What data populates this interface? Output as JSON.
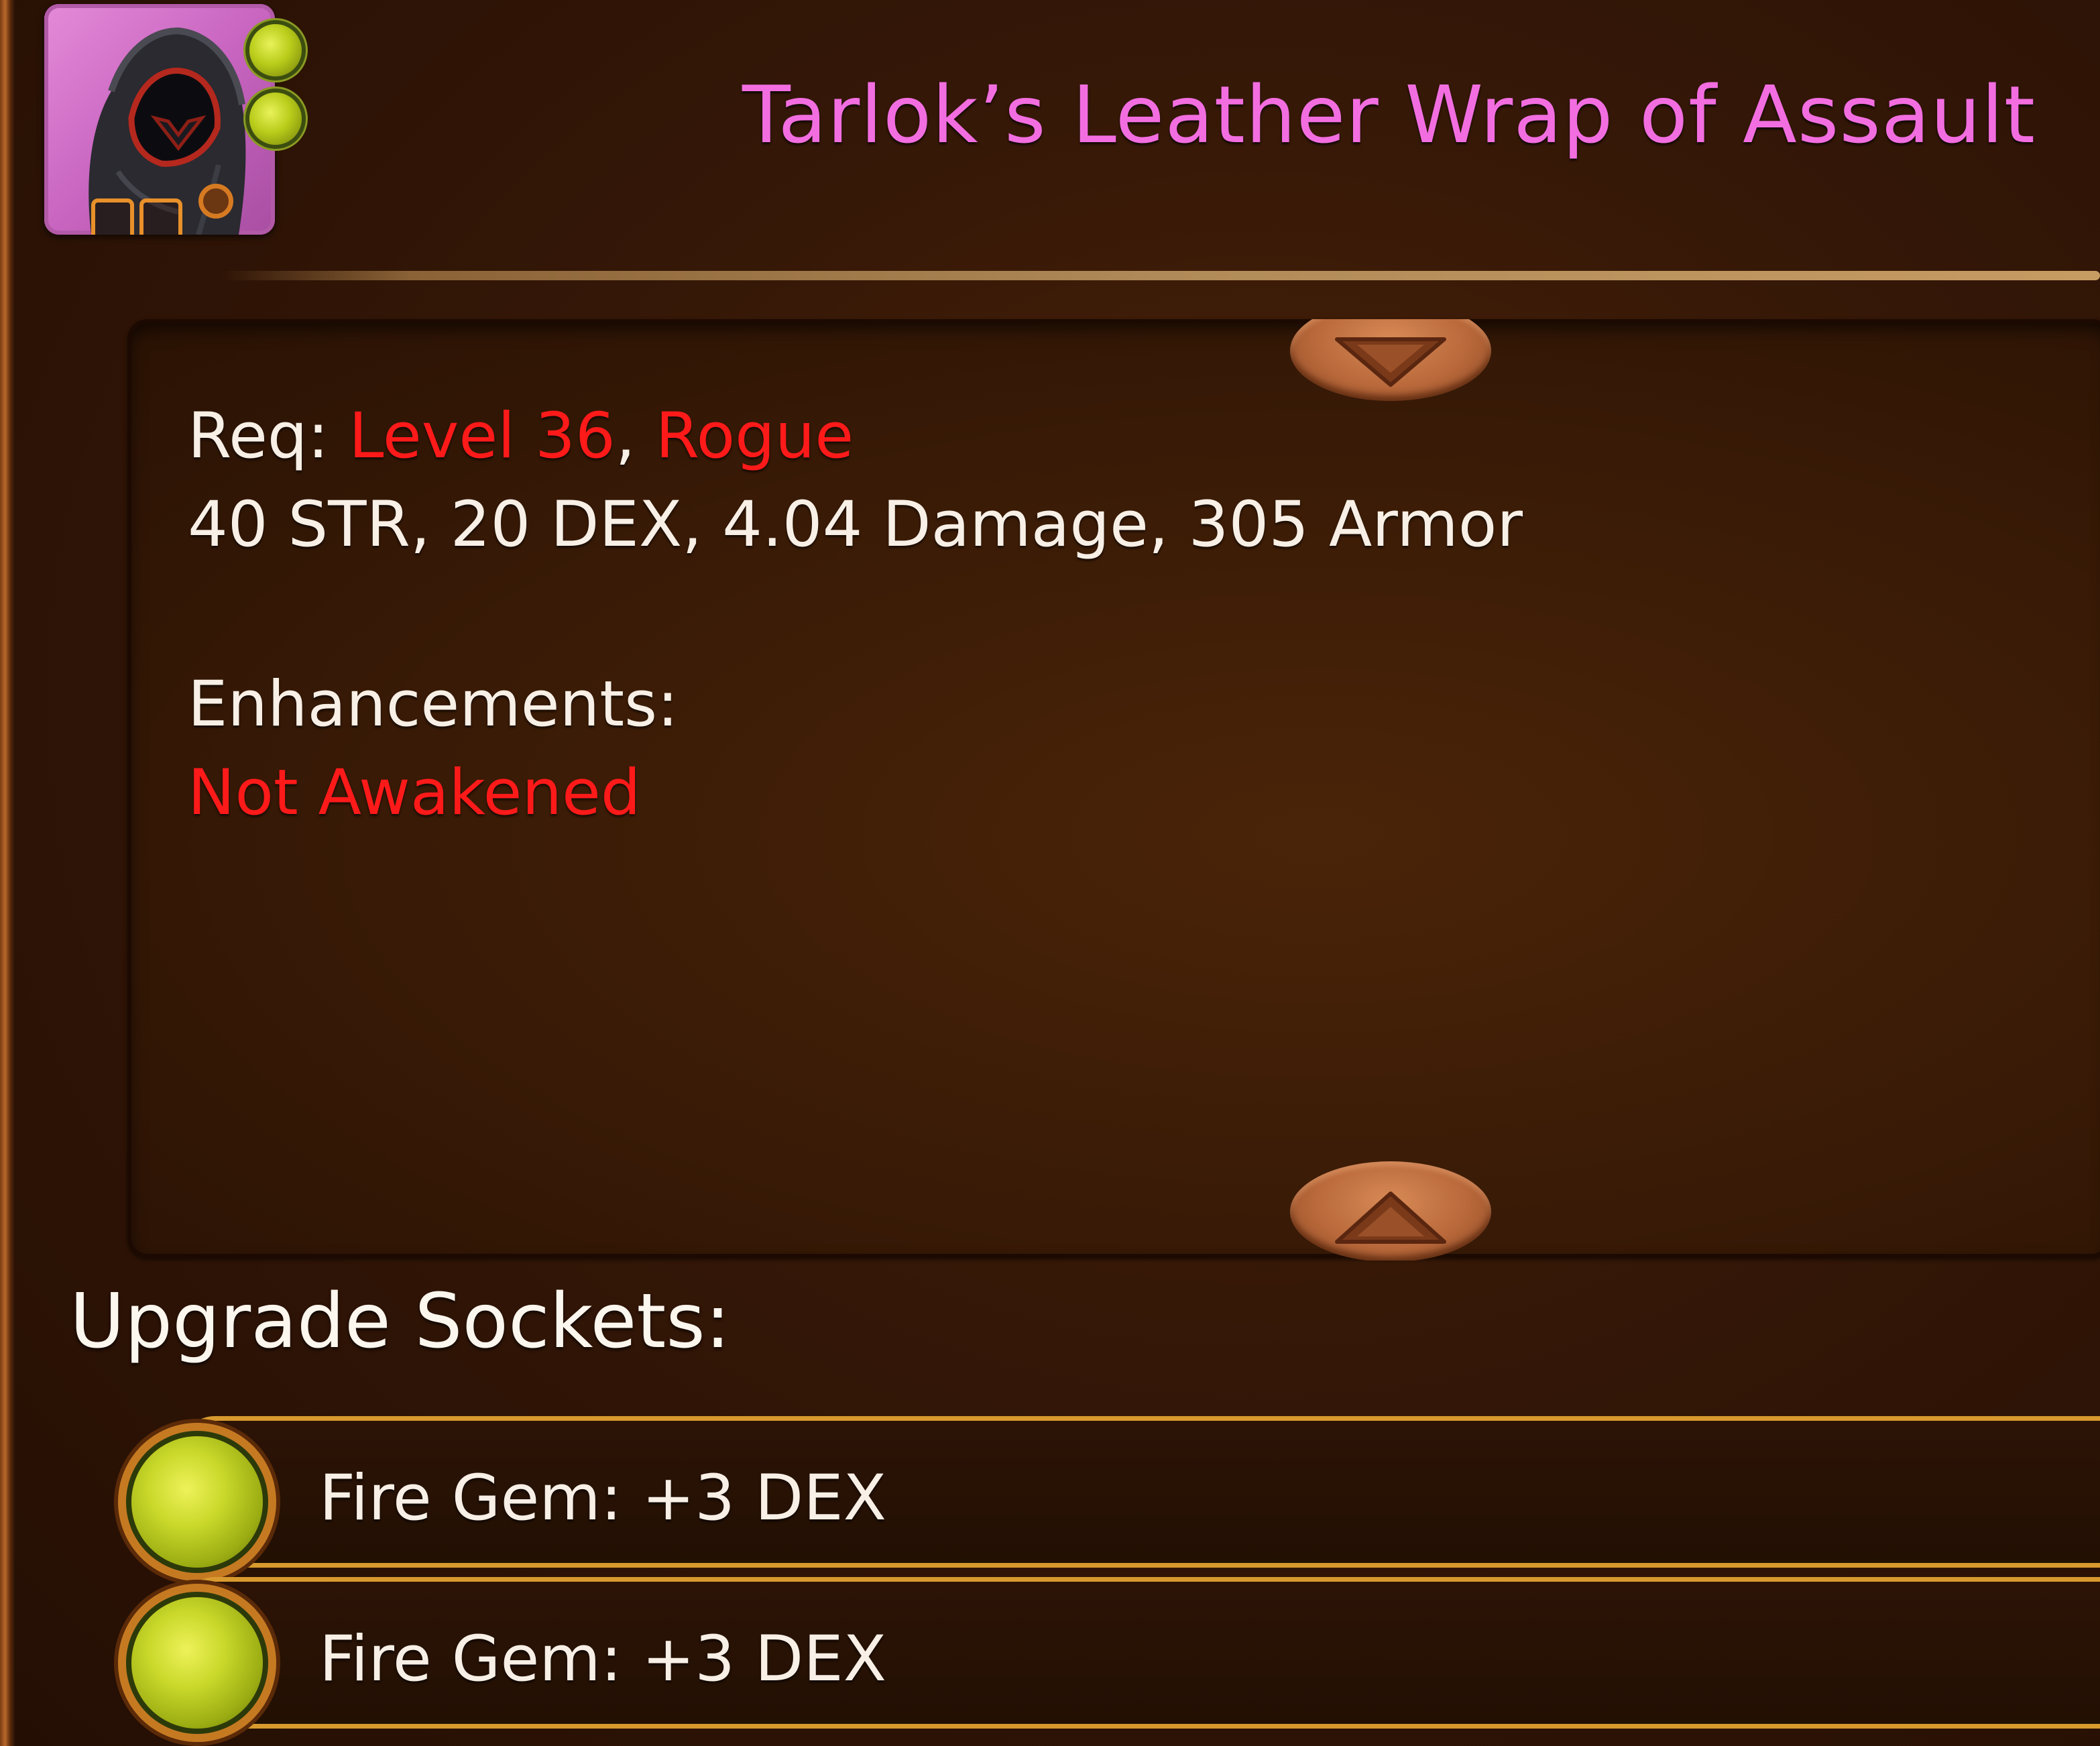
{
  "item": {
    "name": "Tarlok’s Leather Wrap of Assault",
    "name_color": "#f26ee0",
    "icon": "hooded-cloak-icon",
    "rarity_color": "#c865c0"
  },
  "requirements": {
    "label": "Req:",
    "level": "Level 36",
    "separator": ",",
    "class": "Rogue",
    "requirement_color": "#ff1a1a"
  },
  "stats": {
    "line": "40 STR, 20 DEX, 4.04 Damage, 305 Armor"
  },
  "enhancements": {
    "label": "Enhancements:",
    "status": "Not Awakened",
    "status_color": "#ff1a1a"
  },
  "scroll": {
    "up_icon": "scroll-up-icon",
    "down_icon": "scroll-down-icon"
  },
  "sockets": {
    "heading": "Upgrade Sockets:",
    "items": [
      {
        "gem": "fire-gem-icon",
        "text": "Fire Gem: +3 DEX"
      },
      {
        "gem": "fire-gem-icon",
        "text": "Fire Gem: +3 DEX"
      }
    ]
  }
}
